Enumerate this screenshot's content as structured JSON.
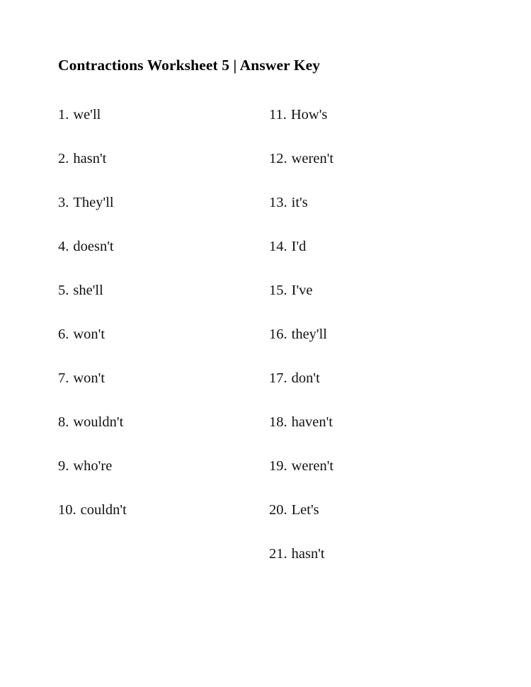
{
  "document": {
    "title": "Contractions Worksheet 5 | Answer Key",
    "background_color": "#ffffff",
    "text_color": "#000000"
  },
  "answers": {
    "left_column": [
      {
        "number": "1.",
        "text": "we'll"
      },
      {
        "number": "2.",
        "text": "hasn't"
      },
      {
        "number": "3.",
        "text": "They'll"
      },
      {
        "number": "4.",
        "text": "doesn't"
      },
      {
        "number": "5.",
        "text": "she'll"
      },
      {
        "number": "6.",
        "text": "won't"
      },
      {
        "number": "7.",
        "text": "won't"
      },
      {
        "number": "8.",
        "text": "wouldn't"
      },
      {
        "number": "9.",
        "text": "who're"
      },
      {
        "number": "10.",
        "text": "couldn't"
      }
    ],
    "right_column": [
      {
        "number": "11.",
        "text": "How's"
      },
      {
        "number": "12.",
        "text": "weren't"
      },
      {
        "number": "13.",
        "text": "it's"
      },
      {
        "number": "14.",
        "text": "I'd"
      },
      {
        "number": "15.",
        "text": "I've"
      },
      {
        "number": "16.",
        "text": "they'll"
      },
      {
        "number": "17.",
        "text": "don't"
      },
      {
        "number": "18.",
        "text": "haven't"
      },
      {
        "number": "19.",
        "text": "weren't"
      },
      {
        "number": "20.",
        "text": "Let's"
      },
      {
        "number": "21.",
        "text": "hasn't"
      }
    ]
  }
}
